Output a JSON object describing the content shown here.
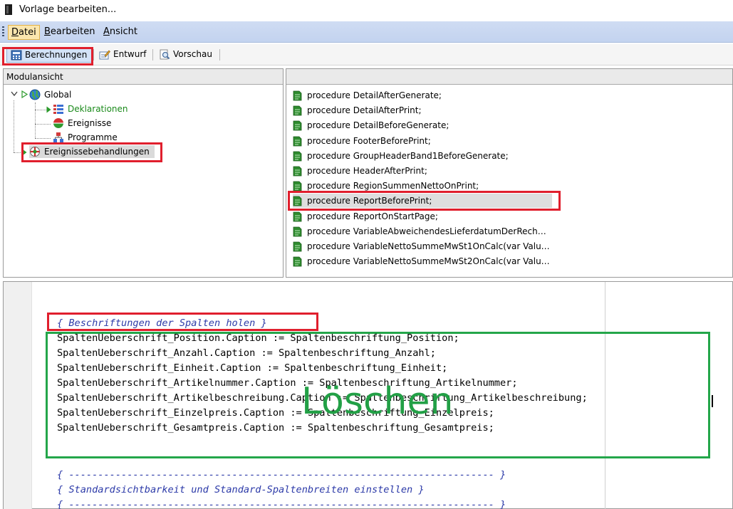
{
  "window": {
    "title": "Vorlage bearbeiten..."
  },
  "menu": {
    "items": [
      {
        "label_u": "D",
        "label_rest": "atei"
      },
      {
        "label_u": "B",
        "label_rest": "earbeiten"
      },
      {
        "label_u": "A",
        "label_rest": "nsicht"
      }
    ]
  },
  "toolbar": {
    "calc_label": "Berechnungen",
    "design_label": "Entwurf",
    "preview_label": "Vorschau"
  },
  "module_view": {
    "header": "Modulansicht",
    "tree": {
      "global": "Global",
      "declarations": "Deklarationen",
      "events": "Ereignisse",
      "programs": "Programme",
      "event_handlers": "Ereignissebehandlungen"
    }
  },
  "procedures": [
    "procedure DetailAfterGenerate;",
    "procedure DetailAfterPrint;",
    "procedure DetailBeforeGenerate;",
    "procedure FooterBeforePrint;",
    "procedure GroupHeaderBand1BeforeGenerate;",
    "procedure HeaderAfterPrint;",
    "procedure RegionSummenNettoOnPrint;",
    "procedure ReportBeforePrint;",
    "procedure ReportOnStartPage;",
    "procedure VariableAbweichendesLieferdatumDerRech…",
    "procedure VariableNettoSummeMwSt1OnCalc(var Valu…",
    "procedure VariableNettoSummeMwSt2OnCalc(var Valu…"
  ],
  "code": {
    "lines": [
      "{ Beschriftungen der Spalten holen }",
      "SpaltenUeberschrift_Position.Caption := Spaltenbeschriftung_Position;",
      "SpaltenUeberschrift_Anzahl.Caption := Spaltenbeschriftung_Anzahl;",
      "SpaltenUeberschrift_Einheit.Caption := Spaltenbeschriftung_Einheit;",
      "SpaltenUeberschrift_Artikelnummer.Caption := Spaltenbeschriftung_Artikelnummer;",
      "SpaltenUeberschrift_Artikelbeschreibung.Caption := Spaltenbeschriftung_Artikelbeschreibung;",
      "SpaltenUeberschrift_Einzelpreis.Caption := Spaltenbeschriftung_Einzelpreis;",
      "SpaltenUeberschrift_Gesamtpreis.Caption := Spaltenbeschriftung_Gesamtpreis;",
      "{ ------------------------------------------------------------------------- }",
      "{ Standardsichtbarkeit und Standard-Spaltenbreiten einstellen }",
      "{ ------------------------------------------------------------------------- }"
    ]
  },
  "annotation": {
    "delete_text": "Löschen"
  },
  "colors": {
    "highlight_red": "#e01f2d",
    "highlight_green": "#24a64a",
    "menu_bar": "#c7d6f0",
    "comment_blue": "#2c3aa8",
    "tree_green": "#1a8a1a"
  }
}
